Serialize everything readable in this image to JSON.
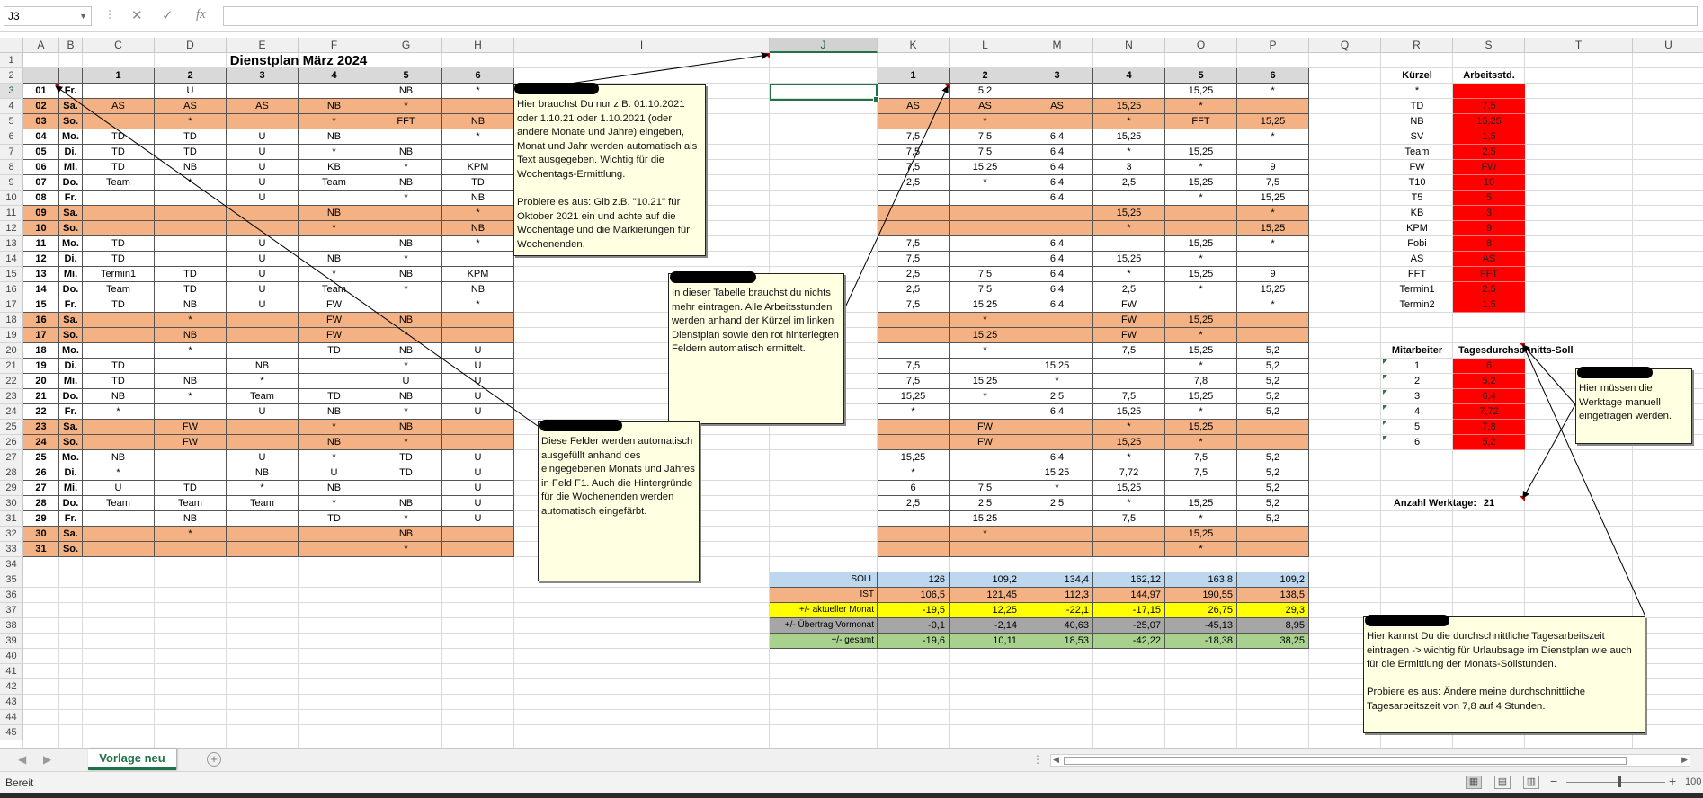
{
  "formula_bar": {
    "name_box": "J3",
    "cancel_icon": "✕",
    "confirm_icon": "✓",
    "fx_label": "fx",
    "formula": ""
  },
  "columns": [
    "A",
    "B",
    "C",
    "D",
    "E",
    "F",
    "G",
    "H",
    "I",
    "J",
    "K",
    "L",
    "M",
    "N",
    "O",
    "P",
    "Q",
    "R",
    "S",
    "T",
    "U"
  ],
  "selected_column": "J",
  "selected_row": 3,
  "title": "Dienstplan  März 2024",
  "left_headers": [
    "1",
    "2",
    "3",
    "4",
    "5",
    "6"
  ],
  "right_headers": [
    "1",
    "2",
    "3",
    "4",
    "5",
    "6"
  ],
  "days": [
    {
      "day": "01",
      "wd": "Fr.",
      "w": false
    },
    {
      "day": "02",
      "wd": "Sa.",
      "w": true
    },
    {
      "day": "03",
      "wd": "So.",
      "w": true
    },
    {
      "day": "04",
      "wd": "Mo.",
      "w": false
    },
    {
      "day": "05",
      "wd": "Di.",
      "w": false
    },
    {
      "day": "06",
      "wd": "Mi.",
      "w": false
    },
    {
      "day": "07",
      "wd": "Do.",
      "w": false
    },
    {
      "day": "08",
      "wd": "Fr.",
      "w": false
    },
    {
      "day": "09",
      "wd": "Sa.",
      "w": true
    },
    {
      "day": "10",
      "wd": "So.",
      "w": true
    },
    {
      "day": "11",
      "wd": "Mo.",
      "w": false
    },
    {
      "day": "12",
      "wd": "Di.",
      "w": false
    },
    {
      "day": "13",
      "wd": "Mi.",
      "w": false
    },
    {
      "day": "14",
      "wd": "Do.",
      "w": false
    },
    {
      "day": "15",
      "wd": "Fr.",
      "w": false
    },
    {
      "day": "16",
      "wd": "Sa.",
      "w": true
    },
    {
      "day": "17",
      "wd": "So.",
      "w": true
    },
    {
      "day": "18",
      "wd": "Mo.",
      "w": false
    },
    {
      "day": "19",
      "wd": "Di.",
      "w": false
    },
    {
      "day": "20",
      "wd": "Mi.",
      "w": false
    },
    {
      "day": "21",
      "wd": "Do.",
      "w": false
    },
    {
      "day": "22",
      "wd": "Fr.",
      "w": false
    },
    {
      "day": "23",
      "wd": "Sa.",
      "w": true
    },
    {
      "day": "24",
      "wd": "So.",
      "w": true
    },
    {
      "day": "25",
      "wd": "Mo.",
      "w": false
    },
    {
      "day": "26",
      "wd": "Di.",
      "w": false
    },
    {
      "day": "27",
      "wd": "Mi.",
      "w": false
    },
    {
      "day": "28",
      "wd": "Do.",
      "w": false
    },
    {
      "day": "29",
      "wd": "Fr.",
      "w": false
    },
    {
      "day": "30",
      "wd": "Sa.",
      "w": true
    },
    {
      "day": "31",
      "wd": "So.",
      "w": true
    }
  ],
  "schedule": [
    [
      "",
      "U",
      "",
      "",
      "NB",
      "*"
    ],
    [
      "AS",
      "AS",
      "AS",
      "NB",
      "*",
      ""
    ],
    [
      "",
      "*",
      "",
      "*",
      "FFT",
      "NB"
    ],
    [
      "TD",
      "TD",
      "U",
      "NB",
      "",
      "*"
    ],
    [
      "TD",
      "TD",
      "U",
      "*",
      "NB",
      ""
    ],
    [
      "TD",
      "NB",
      "U",
      "KB",
      "*",
      "KPM"
    ],
    [
      "Team",
      "*",
      "U",
      "Team",
      "NB",
      "TD"
    ],
    [
      "",
      "",
      "U",
      "",
      "*",
      "NB"
    ],
    [
      "",
      "",
      "",
      "NB",
      "",
      "*"
    ],
    [
      "",
      "",
      "",
      "*",
      "",
      "NB"
    ],
    [
      "TD",
      "",
      "U",
      "",
      "NB",
      "*"
    ],
    [
      "TD",
      "",
      "U",
      "NB",
      "*",
      ""
    ],
    [
      "Termin1",
      "TD",
      "U",
      "*",
      "NB",
      "KPM"
    ],
    [
      "Team",
      "TD",
      "U",
      "Team",
      "*",
      "NB"
    ],
    [
      "TD",
      "NB",
      "U",
      "FW",
      "",
      "*"
    ],
    [
      "",
      "*",
      "",
      "FW",
      "NB",
      ""
    ],
    [
      "",
      "NB",
      "",
      "FW",
      "*",
      ""
    ],
    [
      "",
      "*",
      "",
      "TD",
      "NB",
      "U"
    ],
    [
      "TD",
      "",
      "NB",
      "",
      "*",
      "U"
    ],
    [
      "TD",
      "NB",
      "*",
      "",
      "U",
      "U"
    ],
    [
      "NB",
      "*",
      "Team",
      "TD",
      "NB",
      "U"
    ],
    [
      "*",
      "",
      "U",
      "NB",
      "*",
      "U"
    ],
    [
      "",
      "FW",
      "",
      "*",
      "NB",
      ""
    ],
    [
      "",
      "FW",
      "",
      "NB",
      "*",
      ""
    ],
    [
      "NB",
      "",
      "U",
      "*",
      "TD",
      "U"
    ],
    [
      "*",
      "",
      "NB",
      "U",
      "TD",
      "U"
    ],
    [
      "U",
      "TD",
      "*",
      "NB",
      "",
      "U"
    ],
    [
      "Team",
      "Team",
      "Team",
      "*",
      "NB",
      "U"
    ],
    [
      "",
      "NB",
      "",
      "TD",
      "*",
      "U"
    ],
    [
      "",
      "*",
      "",
      "",
      "NB",
      ""
    ],
    [
      "",
      "",
      "",
      "",
      "*",
      ""
    ]
  ],
  "hours": [
    [
      "",
      "5,2",
      "",
      "",
      "15,25",
      "*"
    ],
    [
      "AS",
      "AS",
      "AS",
      "15,25",
      "*",
      ""
    ],
    [
      "",
      "*",
      "",
      "*",
      "FFT",
      "15,25"
    ],
    [
      "7,5",
      "7,5",
      "6,4",
      "15,25",
      "",
      "*"
    ],
    [
      "7,5",
      "7,5",
      "6,4",
      "*",
      "15,25",
      ""
    ],
    [
      "7,5",
      "15,25",
      "6,4",
      "3",
      "*",
      "9"
    ],
    [
      "2,5",
      "*",
      "6,4",
      "2,5",
      "15,25",
      "7,5"
    ],
    [
      "",
      "",
      "6,4",
      "",
      "*",
      "15,25"
    ],
    [
      "",
      "",
      "",
      "15,25",
      "",
      "*"
    ],
    [
      "",
      "",
      "",
      "*",
      "",
      "15,25"
    ],
    [
      "7,5",
      "",
      "6,4",
      "",
      "15,25",
      "*"
    ],
    [
      "7,5",
      "",
      "6,4",
      "15,25",
      "*",
      ""
    ],
    [
      "2,5",
      "7,5",
      "6,4",
      "*",
      "15,25",
      "9"
    ],
    [
      "2,5",
      "7,5",
      "6,4",
      "2,5",
      "*",
      "15,25"
    ],
    [
      "7,5",
      "15,25",
      "6,4",
      "FW",
      "",
      "*"
    ],
    [
      "",
      "*",
      "",
      "FW",
      "15,25",
      ""
    ],
    [
      "",
      "15,25",
      "",
      "FW",
      "*",
      ""
    ],
    [
      "",
      "*",
      "",
      "7,5",
      "15,25",
      "5,2"
    ],
    [
      "7,5",
      "",
      "15,25",
      "",
      "*",
      "5,2"
    ],
    [
      "7,5",
      "15,25",
      "*",
      "",
      "7,8",
      "5,2"
    ],
    [
      "15,25",
      "*",
      "2,5",
      "7,5",
      "15,25",
      "5,2"
    ],
    [
      "*",
      "",
      "6,4",
      "15,25",
      "*",
      "5,2"
    ],
    [
      "",
      "FW",
      "",
      "*",
      "15,25",
      ""
    ],
    [
      "",
      "FW",
      "",
      "15,25",
      "*",
      ""
    ],
    [
      "15,25",
      "",
      "6,4",
      "*",
      "7,5",
      "5,2"
    ],
    [
      "*",
      "",
      "15,25",
      "7,72",
      "7,5",
      "5,2"
    ],
    [
      "6",
      "7,5",
      "*",
      "15,25",
      "",
      "5,2"
    ],
    [
      "2,5",
      "2,5",
      "2,5",
      "*",
      "15,25",
      "5,2"
    ],
    [
      "",
      "15,25",
      "",
      "7,5",
      "*",
      "5,2"
    ],
    [
      "",
      "*",
      "",
      "",
      "15,25",
      ""
    ],
    [
      "",
      "",
      "",
      "",
      "*",
      ""
    ]
  ],
  "summary": [
    {
      "label": "SOLL",
      "cls": "s-soll",
      "values": [
        "126",
        "109,2",
        "134,4",
        "162,12",
        "163,8",
        "109,2"
      ]
    },
    {
      "label": "IST",
      "cls": "s-ist",
      "values": [
        "106,5",
        "121,45",
        "112,3",
        "144,97",
        "190,55",
        "138,5"
      ]
    },
    {
      "label": "+/- aktueller Monat",
      "cls": "s-akt",
      "values": [
        "-19,5",
        "12,25",
        "-22,1",
        "-17,15",
        "26,75",
        "29,3"
      ]
    },
    {
      "label": "+/- Übertrag Vormonat",
      "cls": "s-ueb",
      "values": [
        "-0,1",
        "-2,14",
        "40,63",
        "-25,07",
        "-45,13",
        "8,95"
      ]
    },
    {
      "label": "+/- gesamt",
      "cls": "s-ges",
      "values": [
        "-19,6",
        "10,11",
        "18,53",
        "-42,22",
        "-18,38",
        "38,25"
      ]
    }
  ],
  "codes_header": {
    "code": "Kürzel",
    "hours": "Arbeitsstd."
  },
  "codes": [
    {
      "code": "*",
      "hours": ""
    },
    {
      "code": "TD",
      "hours": "7,5"
    },
    {
      "code": "NB",
      "hours": "15,25"
    },
    {
      "code": "SV",
      "hours": "1,5"
    },
    {
      "code": "Team",
      "hours": "2,5"
    },
    {
      "code": "FW",
      "hours": "FW"
    },
    {
      "code": "T10",
      "hours": "10"
    },
    {
      "code": "T5",
      "hours": "5"
    },
    {
      "code": "KB",
      "hours": "3"
    },
    {
      "code": "KPM",
      "hours": "9"
    },
    {
      "code": "Fobi",
      "hours": "8"
    },
    {
      "code": "AS",
      "hours": "AS"
    },
    {
      "code": "FFT",
      "hours": "FFT"
    },
    {
      "code": "Termin1",
      "hours": "2,5"
    },
    {
      "code": "Termin2",
      "hours": "1,5"
    }
  ],
  "staff_header": {
    "worker": "Mitarbeiter",
    "target": "Tagesdurchschnitts-Soll"
  },
  "staff": [
    {
      "id": "1",
      "target": "6"
    },
    {
      "id": "2",
      "target": "5,2"
    },
    {
      "id": "3",
      "target": "6,4"
    },
    {
      "id": "4",
      "target": "7,72"
    },
    {
      "id": "5",
      "target": "7,8"
    },
    {
      "id": "6",
      "target": "5,2"
    }
  ],
  "workdays": {
    "label": "Anzahl Werktage:",
    "value": "21"
  },
  "notes": {
    "n1": "Hier brauchst Du nur z.B. 01.10.2021 oder 1.10.21 oder 1.10.2021 (oder andere Monate und Jahre) eingeben, Monat und Jahr werden automatisch als Text ausgegeben. Wichtig für die Wochentags-Ermittlung.\n\nProbiere es aus: Gib z.B. \"10.21\" für Oktober 2021 ein und achte auf die Wochentage und die Markierungen für Wochenenden.",
    "n2": "In dieser Tabelle brauchst du nichts mehr eintragen. Alle Arbeitsstunden werden anhand der Kürzel im linken Dienstplan sowie den rot hinterlegten Feldern automatisch ermittelt.",
    "n3": "Diese Felder werden automatisch ausgefüllt anhand des eingegebenen Monats und Jahres in Feld F1. Auch die Hintergründe für die Wochenenden werden automatisch eingefärbt.",
    "n4": "Hier müssen die Werktage manuell eingetragen werden.",
    "n5": "Hier kannst Du die durchschnittliche Tagesarbeitszeit eintragen -> wichtig für Urlaubsage im Dienstplan wie auch für die Ermittlung der Monats-Sollstunden.\n\nProbiere es aus: Ändere meine durchschnittliche Tagesarbeitszeit von 7,8 auf 4 Stunden."
  },
  "sheet_tab": "Vorlage neu",
  "status": "Bereit",
  "zoom": "100"
}
